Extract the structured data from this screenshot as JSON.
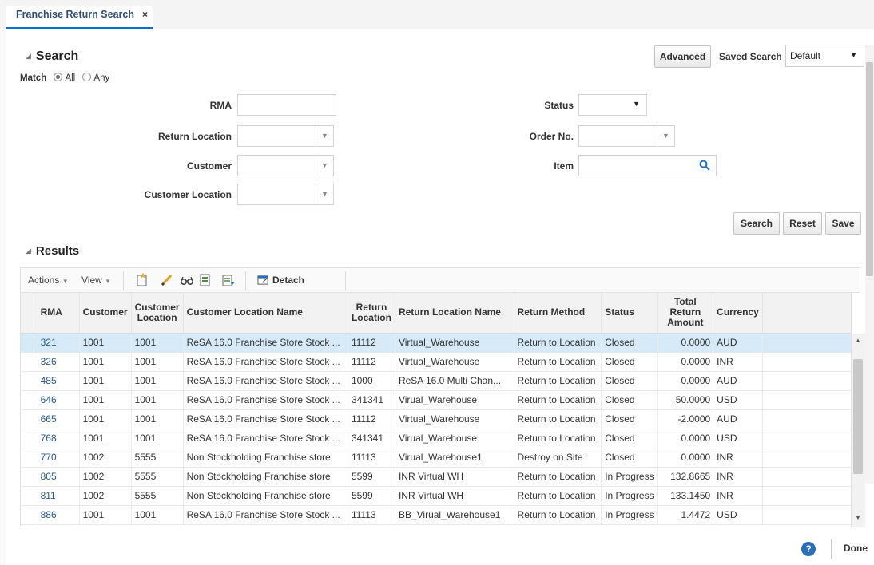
{
  "tab": {
    "label": "Franchise Return Search",
    "close": "×"
  },
  "search": {
    "title": "Search",
    "match_label": "Match",
    "match_all": "All",
    "match_any": "Any",
    "advanced_label": "Advanced",
    "saved_search_label": "Saved Search",
    "saved_search_value": "Default",
    "fields": {
      "rma": "RMA",
      "return_location": "Return Location",
      "customer": "Customer",
      "customer_location": "Customer Location",
      "status": "Status",
      "order_no": "Order No.",
      "item": "Item"
    },
    "buttons": {
      "search": "Search",
      "reset": "Reset",
      "save": "Save"
    }
  },
  "results": {
    "title": "Results",
    "toolbar": {
      "actions": "Actions",
      "view": "View",
      "detach": "Detach"
    },
    "columns": {
      "rma": "RMA",
      "customer": "Customer",
      "customer_location": "Customer Location",
      "customer_location_name": "Customer Location Name",
      "return_location": "Return Location",
      "return_location_name": "Return Location Name",
      "return_method": "Return Method",
      "status": "Status",
      "total_return_amount": "Total Return Amount",
      "currency": "Currency"
    },
    "rows": [
      {
        "rma": "321",
        "customer": "1001",
        "cust_loc": "1001",
        "cust_loc_name": "ReSA 16.0 Franchise Store Stock ...",
        "ret_loc": "11112",
        "ret_loc_name": "Virtual_Warehouse",
        "method": "Return to Location",
        "status": "Closed",
        "amount": "0.0000",
        "currency": "AUD"
      },
      {
        "rma": "326",
        "customer": "1001",
        "cust_loc": "1001",
        "cust_loc_name": "ReSA 16.0 Franchise Store Stock ...",
        "ret_loc": "11112",
        "ret_loc_name": "Virtual_Warehouse",
        "method": "Return to Location",
        "status": "Closed",
        "amount": "0.0000",
        "currency": "INR"
      },
      {
        "rma": "485",
        "customer": "1001",
        "cust_loc": "1001",
        "cust_loc_name": "ReSA 16.0 Franchise Store Stock ...",
        "ret_loc": "1000",
        "ret_loc_name": "ReSA 16.0 Multi Chan...",
        "method": "Return to Location",
        "status": "Closed",
        "amount": "0.0000",
        "currency": "AUD"
      },
      {
        "rma": "646",
        "customer": "1001",
        "cust_loc": "1001",
        "cust_loc_name": "ReSA 16.0 Franchise Store Stock ...",
        "ret_loc": "341341",
        "ret_loc_name": "Virual_Warehouse",
        "method": "Return to Location",
        "status": "Closed",
        "amount": "50.0000",
        "currency": "USD"
      },
      {
        "rma": "665",
        "customer": "1001",
        "cust_loc": "1001",
        "cust_loc_name": "ReSA 16.0 Franchise Store Stock ...",
        "ret_loc": "11112",
        "ret_loc_name": "Virtual_Warehouse",
        "method": "Return to Location",
        "status": "Closed",
        "amount": "-2.0000",
        "currency": "AUD"
      },
      {
        "rma": "768",
        "customer": "1001",
        "cust_loc": "1001",
        "cust_loc_name": "ReSA 16.0 Franchise Store Stock ...",
        "ret_loc": "341341",
        "ret_loc_name": "Virual_Warehouse",
        "method": "Return to Location",
        "status": "Closed",
        "amount": "0.0000",
        "currency": "USD"
      },
      {
        "rma": "770",
        "customer": "1002",
        "cust_loc": "5555",
        "cust_loc_name": "Non Stockholding Franchise store",
        "ret_loc": "11113",
        "ret_loc_name": "Virual_Warehouse1",
        "method": "Destroy on Site",
        "status": "Closed",
        "amount": "0.0000",
        "currency": "INR"
      },
      {
        "rma": "805",
        "customer": "1002",
        "cust_loc": "5555",
        "cust_loc_name": "Non Stockholding Franchise store",
        "ret_loc": "5599",
        "ret_loc_name": "INR Virtual WH",
        "method": "Return to Location",
        "status": "In Progress",
        "amount": "132.8665",
        "currency": "INR"
      },
      {
        "rma": "811",
        "customer": "1002",
        "cust_loc": "5555",
        "cust_loc_name": "Non Stockholding Franchise store",
        "ret_loc": "5599",
        "ret_loc_name": "INR Virtual WH",
        "method": "Return to Location",
        "status": "In Progress",
        "amount": "133.1450",
        "currency": "INR"
      },
      {
        "rma": "886",
        "customer": "1001",
        "cust_loc": "1001",
        "cust_loc_name": "ReSA 16.0 Franchise Store Stock ...",
        "ret_loc": "11113",
        "ret_loc_name": "BB_Virual_Warehouse1",
        "method": "Return to Location",
        "status": "In Progress",
        "amount": "1.4472",
        "currency": "USD"
      }
    ]
  },
  "footer": {
    "help": "?",
    "done": "Done"
  },
  "colors": {
    "accent": "#0572ce",
    "link": "#2c5a8a",
    "selected_row": "#d6eaf8"
  }
}
